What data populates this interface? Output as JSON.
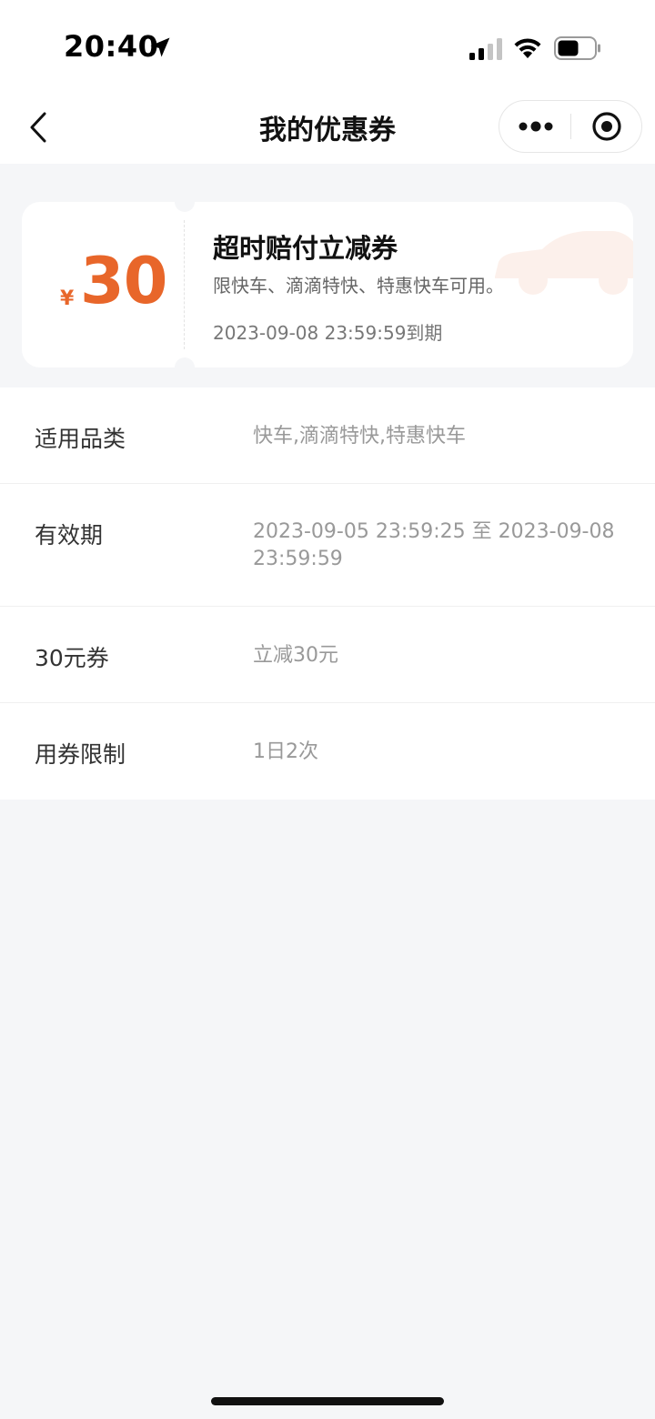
{
  "status_bar": {
    "time": "20:40",
    "icons": [
      "location-arrow-icon",
      "cellular-signal-icon",
      "wifi-icon",
      "battery-icon"
    ]
  },
  "nav": {
    "title": "我的优惠券",
    "back_icon": "chevron-left-icon",
    "more_icon": "more-dots-icon",
    "close_icon": "target-circle-icon"
  },
  "coupon": {
    "currency": "¥",
    "amount": "30",
    "title": "超时赔付立减券",
    "description": "限快车、滴滴特快、特惠快车可用。",
    "expiry": "2023-09-08 23:59:59到期",
    "accent_color": "#e8662a",
    "watermark_icon": "car-icon"
  },
  "details": [
    {
      "label": "适用品类",
      "value": "快车,滴滴特快,特惠快车"
    },
    {
      "label": "有效期",
      "value": "2023-09-05 23:59:25 至 2023-09-08 23:59:59"
    },
    {
      "label": "30元券",
      "value": "立减30元"
    },
    {
      "label": "用券限制",
      "value": "1日2次"
    }
  ]
}
